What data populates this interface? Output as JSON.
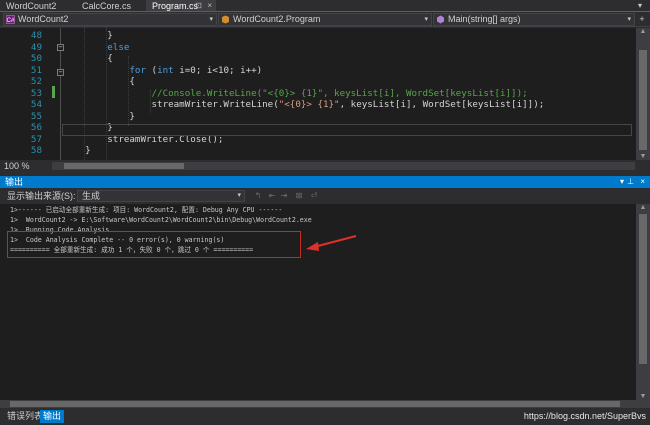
{
  "tabs": [
    {
      "label": "WordCount2",
      "active": false
    },
    {
      "label": "CalcCore.cs",
      "active": false
    },
    {
      "label": "Program.cs",
      "active": true,
      "pin": "⊡",
      "close": "×"
    }
  ],
  "tabs_overflow": "▾",
  "navbar": {
    "project": "WordCount2",
    "type": "WordCount2.Program",
    "member": "Main(string[] args)",
    "dropdown_glyph": "▾",
    "split_glyph": "+"
  },
  "editor": {
    "lines": [
      {
        "num": "48",
        "html": "        }"
      },
      {
        "num": "49",
        "html": "        <span class=\"kw\">else</span>"
      },
      {
        "num": "50",
        "html": "        {"
      },
      {
        "num": "51",
        "html": "            <span class=\"kw\">for</span> (<span class=\"kw\">int</span> i=0; i&lt;10; i++)"
      },
      {
        "num": "52",
        "html": "            {"
      },
      {
        "num": "53",
        "html": "                <span class=\"cm\">//Console.WriteLine(\"&lt;{0}&gt; {1}\", keysList[i], WordSet[keysList[i]]);</span>"
      },
      {
        "num": "54",
        "html": "                streamWriter.WriteLine(<span class=\"str\">\"&lt;{0}&gt; {1}\"</span>, keysList[i], WordSet[keysList[i]]);"
      },
      {
        "num": "55",
        "html": "            }"
      },
      {
        "num": "56",
        "html": "        }"
      },
      {
        "num": "57",
        "html": "        streamWriter.Close();"
      },
      {
        "num": "58",
        "html": "    }"
      }
    ],
    "zoom": "100 %"
  },
  "output": {
    "title": "输出",
    "pin_glyph": "▾",
    "autohide_glyph": "⊥",
    "close_glyph": "×",
    "source_label": "显示输出来源(S):",
    "source_value": "生成",
    "source_dropdown": "▾",
    "toolbar_glyphs": [
      "↰",
      "⇤",
      "⇥",
      "⊠",
      "⏎"
    ],
    "lines": [
      "1>------ 已启动全部重新生成: 项目: WordCount2, 配置: Debug Any CPU ------",
      "1>  WordCount2 -> E:\\Software\\WordCount2\\WordCount2\\bin\\Debug\\WordCount2.exe",
      "1>  Running Code Analysis...",
      "1>  Code Analysis Complete -- 0 error(s), 0 warning(s)",
      "========== 全部重新生成: 成功 1 个，失败 0 个，跳过 0 个 =========="
    ]
  },
  "bottom_tabs": [
    {
      "label": "错误列表",
      "active": false
    },
    {
      "label": "输出",
      "active": true
    }
  ],
  "watermark": "https://blog.csdn.net/SuperBvs",
  "scroll_glyphs": {
    "up": "▲",
    "down": "▼"
  },
  "colors": {
    "accent": "#007acc",
    "annotation_red": "#e0302a",
    "keyword": "#569cd6",
    "comment": "#57a64a",
    "string": "#d69d85",
    "line_number": "#2b91af"
  }
}
